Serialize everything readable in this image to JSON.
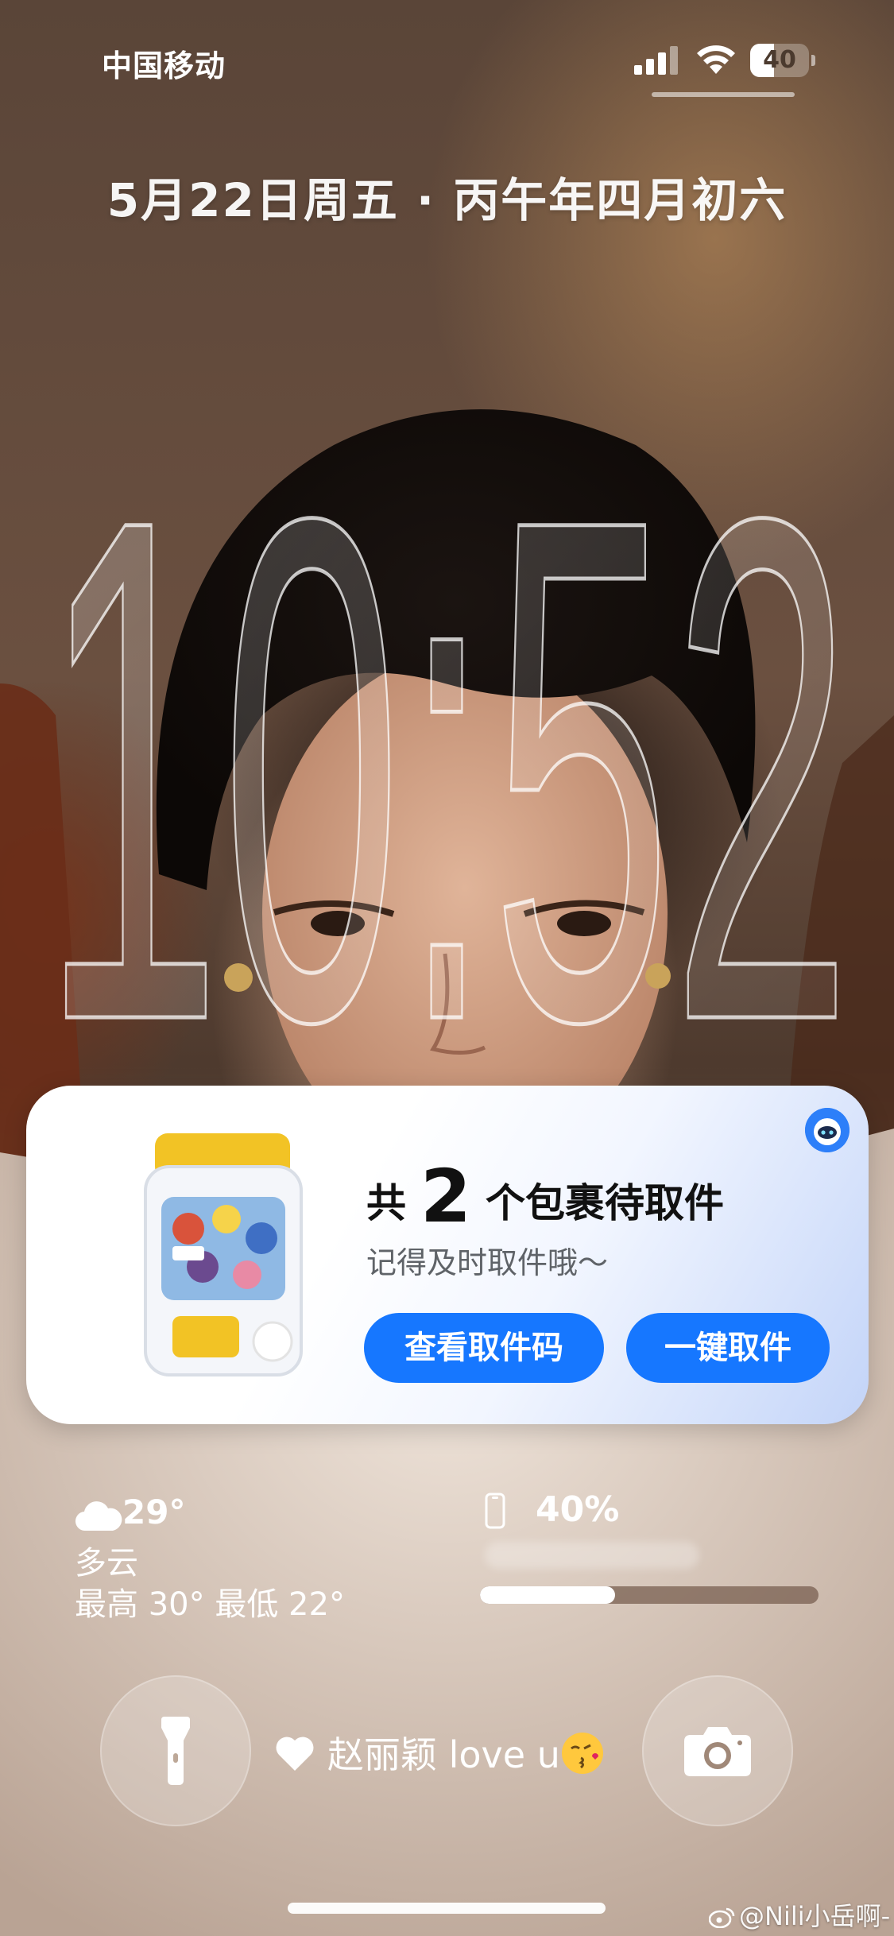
{
  "status_bar": {
    "carrier": "中国移动",
    "battery_level": 40,
    "battery_text": "40",
    "signal_icon": "cellular-signal-icon",
    "wifi_icon": "wifi-icon"
  },
  "lock_screen": {
    "date": "5月22日周五 · 丙午年四月初六",
    "time": "10:52"
  },
  "package_card": {
    "prefix": "共",
    "count": "2",
    "suffix": "个包裹待取件",
    "subtitle": "记得及时取件哦～",
    "view_code_button": "查看取件码",
    "one_tap_pickup_button": "一键取件",
    "accent": "#1677ff",
    "app_icon": "robot-mascot-icon",
    "image_icon": "sticker-jar-image"
  },
  "weather": {
    "icon": "cloud-icon",
    "temperature": "29°",
    "condition": "多云",
    "range": "最高 30° 最低 22°"
  },
  "battery_widget": {
    "icon": "phone-icon",
    "percent_text": "40%",
    "level": 0.4
  },
  "quick_actions": {
    "flashlight_icon": "flashlight-icon",
    "camera_icon": "camera-icon"
  },
  "signature": {
    "text": "赵丽颖 love u",
    "heart_icon": "heart-icon",
    "emoji": "kissing-face-emoji"
  },
  "watermark": {
    "text": "@Nili小岳啊-",
    "icon": "weibo-icon"
  }
}
